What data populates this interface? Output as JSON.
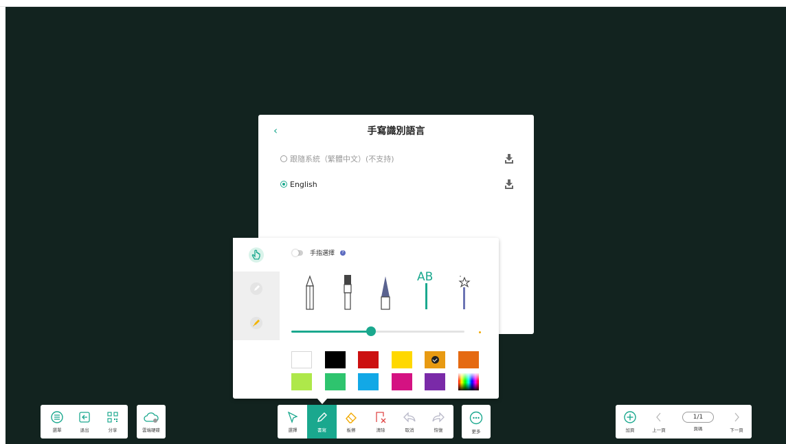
{
  "language_dialog": {
    "back_icon": "chevron-left-icon",
    "title": "手寫識別語言",
    "options": [
      {
        "label": "跟隨系統（繁體中文）(不支持)",
        "selected": false
      },
      {
        "label": "English",
        "selected": true
      }
    ]
  },
  "pen_panel": {
    "finger_select_label": "手指選擇",
    "finger_select_on": false,
    "help_icon": "help-icon",
    "tabs": [
      "finger-touch-icon",
      "pen-icon",
      "highlighter-icon"
    ],
    "pen_types": [
      "pencil-icon",
      "brush-icon",
      "fountain-pen-icon",
      "text-recognition-pen-icon",
      "magic-wand-pen-icon"
    ],
    "pen_text_glyph": "AB",
    "stroke_size_fraction": 0.46,
    "colors": [
      {
        "hex": "#ffffff",
        "selected": false
      },
      {
        "hex": "#000000",
        "selected": false
      },
      {
        "hex": "#cc1010",
        "selected": false
      },
      {
        "hex": "#ffd800",
        "selected": false
      },
      {
        "hex": "#e89a12",
        "selected": true
      },
      {
        "hex": "#e56a12",
        "selected": false
      },
      {
        "hex": "#aee84a",
        "selected": false
      },
      {
        "hex": "#2ec46e",
        "selected": false
      },
      {
        "hex": "#12a8e6",
        "selected": false
      },
      {
        "hex": "#d41282",
        "selected": false
      },
      {
        "hex": "#7a2aa8",
        "selected": false
      },
      {
        "hex": "rainbow",
        "selected": false
      }
    ]
  },
  "left_toolbar": {
    "menu": "選單",
    "exit": "退出",
    "share": "分享",
    "cloud": "雲端硬碟"
  },
  "center_toolbar": {
    "select": "選擇",
    "write": "書寫",
    "erase": "板擦",
    "clear": "清除",
    "undo": "取消",
    "redo": "恢復",
    "more": "更多"
  },
  "right_toolbar": {
    "add_page": "加頁",
    "prev_page": "上一頁",
    "page_indicator": "1/1",
    "page_code": "頁碼",
    "next_page": "下一頁"
  },
  "colors": {
    "accent": "#1aa88e",
    "board": "#12231f"
  }
}
